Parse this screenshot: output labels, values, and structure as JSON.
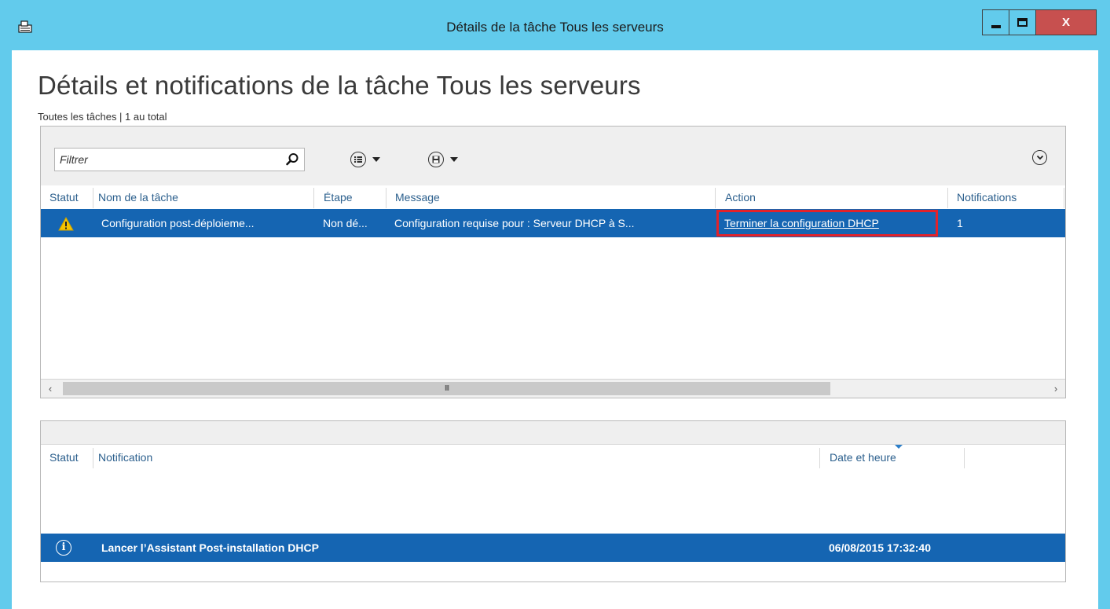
{
  "window": {
    "title": "Détails de la tâche Tous les serveurs",
    "close_label": "X"
  },
  "page": {
    "title": "Détails et notifications de la tâche Tous les serveurs",
    "subtitle": "Toutes les tâches | 1 au total"
  },
  "toolbar": {
    "filter_placeholder": "Filtrer",
    "icons": [
      "search-icon",
      "list-options-icon",
      "save-icon",
      "collapse-icon"
    ]
  },
  "tasks_table": {
    "columns": [
      "Statut",
      "Nom de la tâche",
      "Étape",
      "Message",
      "Action",
      "Notifications"
    ],
    "rows": [
      {
        "status_icon": "warning-icon",
        "name": "Configuration post-déploieme...",
        "stage": "Non dé...",
        "message": "Configuration requise pour : Serveur DHCP à S...",
        "action": "Terminer la configuration DHCP",
        "notifications": "1"
      }
    ],
    "scrollbar_thumb_label": "III"
  },
  "notifications_table": {
    "columns": [
      "Statut",
      "Notification",
      "Date et heure"
    ],
    "rows": [
      {
        "status_icon": "info-icon",
        "notification": "Lancer l’Assistant Post-installation DHCP",
        "datetime": "06/08/2015 17:32:40"
      }
    ]
  },
  "colors": {
    "title_bar": "#62cbec",
    "selection": "#1565b2",
    "highlight": "#e2222a",
    "close_button": "#c7504f",
    "header_text": "#2b5f8d"
  }
}
